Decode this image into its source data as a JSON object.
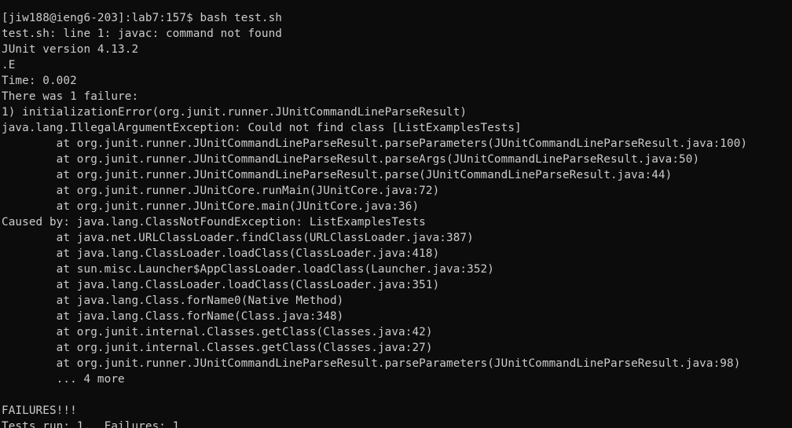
{
  "terminal": {
    "lines": [
      "",
      "[jiw188@ieng6-203]:lab7:157$ bash test.sh",
      "test.sh: line 1: javac: command not found",
      "JUnit version 4.13.2",
      ".E",
      "Time: 0.002",
      "There was 1 failure:",
      "1) initializationError(org.junit.runner.JUnitCommandLineParseResult)",
      "java.lang.IllegalArgumentException: Could not find class [ListExamplesTests]",
      "        at org.junit.runner.JUnitCommandLineParseResult.parseParameters(JUnitCommandLineParseResult.java:100)",
      "        at org.junit.runner.JUnitCommandLineParseResult.parseArgs(JUnitCommandLineParseResult.java:50)",
      "        at org.junit.runner.JUnitCommandLineParseResult.parse(JUnitCommandLineParseResult.java:44)",
      "        at org.junit.runner.JUnitCore.runMain(JUnitCore.java:72)",
      "        at org.junit.runner.JUnitCore.main(JUnitCore.java:36)",
      "Caused by: java.lang.ClassNotFoundException: ListExamplesTests",
      "        at java.net.URLClassLoader.findClass(URLClassLoader.java:387)",
      "        at java.lang.ClassLoader.loadClass(ClassLoader.java:418)",
      "        at sun.misc.Launcher$AppClassLoader.loadClass(Launcher.java:352)",
      "        at java.lang.ClassLoader.loadClass(ClassLoader.java:351)",
      "        at java.lang.Class.forName0(Native Method)",
      "        at java.lang.Class.forName(Class.java:348)",
      "        at org.junit.internal.Classes.getClass(Classes.java:42)",
      "        at org.junit.internal.Classes.getClass(Classes.java:27)",
      "        at org.junit.runner.JUnitCommandLineParseResult.parseParameters(JUnitCommandLineParseResult.java:98)",
      "        ... 4 more",
      "",
      "FAILURES!!!",
      "Tests run: 1,  Failures: 1"
    ],
    "colors": {
      "background": "#0c0c0c",
      "foreground": "#cccccc"
    }
  }
}
